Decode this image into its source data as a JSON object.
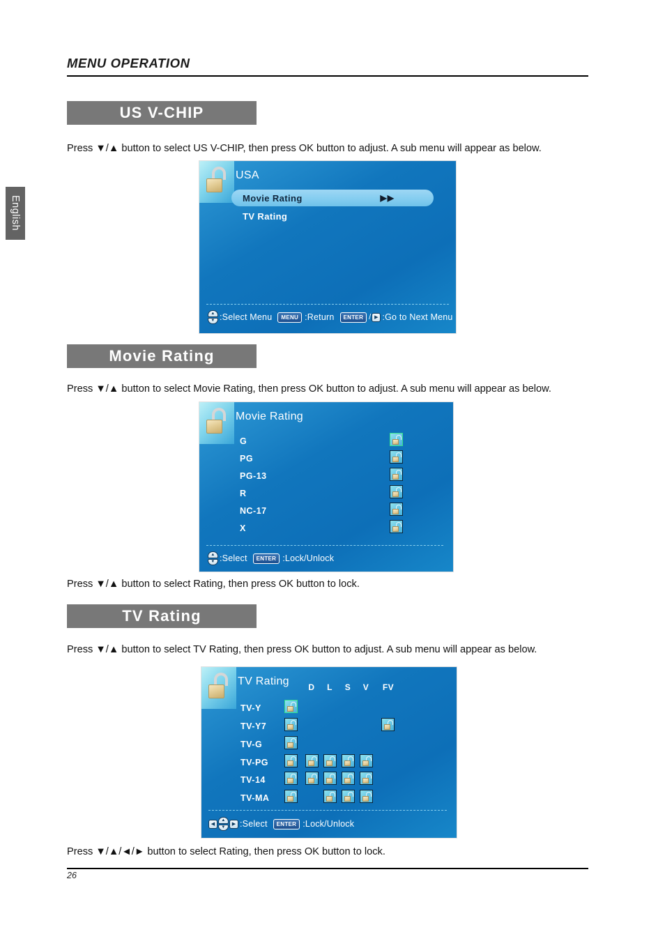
{
  "page": {
    "running_head": "MENU OPERATION",
    "page_number": "26",
    "language_tab": "English"
  },
  "sections": [
    {
      "id": "us-vchip",
      "title": "US  V-CHIP",
      "paragraph": "Press ▼/▲ button to select US V-CHIP, then press OK button to adjust. A sub menu will appear as below."
    },
    {
      "id": "movie-rating",
      "title": "Movie  Rating",
      "paragraph": "Press ▼/▲ button to select Movie Rating, then press OK button to adjust. A sub menu will appear as below.",
      "after_paragraph": "Press ▼/▲ button to select Rating, then press OK button to lock."
    },
    {
      "id": "tv-rating",
      "title": "TV  Rating",
      "paragraph": "Press ▼/▲ button to select TV Rating, then press OK button to adjust. A sub menu will appear as below.",
      "after_paragraph": "Press ▼/▲/◄/► button to select Rating, then press OK button to lock."
    }
  ],
  "osd_usa": {
    "title": "USA",
    "lock_icon": "open-padlock-icon",
    "items": [
      {
        "label": "Movie  Rating",
        "selected": true,
        "arrows": "▶▶"
      },
      {
        "label": "TV  Rating",
        "selected": false
      }
    ],
    "footer": {
      "select_icon": "up-down-key-icon",
      "select_label": ":Select Menu",
      "menu_key": "MENU",
      "return_label": ":Return",
      "enter_key": "ENTER",
      "right_key_icon": "right-arrow-key-icon",
      "next_label": ":Go to Next Menu"
    }
  },
  "osd_movie": {
    "title": "Movie  Rating",
    "lock_icon": "open-padlock-icon",
    "ratings": [
      {
        "label": "G",
        "locked": false,
        "selected": true
      },
      {
        "label": "PG",
        "locked": false,
        "selected": false
      },
      {
        "label": "PG-13",
        "locked": false,
        "selected": false
      },
      {
        "label": "R",
        "locked": false,
        "selected": false
      },
      {
        "label": "NC-17",
        "locked": false,
        "selected": false
      },
      {
        "label": "X",
        "locked": false,
        "selected": false
      }
    ],
    "footer": {
      "select_icon": "up-down-key-icon",
      "select_label": ":Select",
      "enter_key": "ENTER",
      "lock_label": ":Lock/Unlock"
    }
  },
  "osd_tv": {
    "title": "TV  Rating",
    "lock_icon": "open-padlock-icon",
    "columns": [
      "D",
      "L",
      "S",
      "V",
      "FV"
    ],
    "rows": [
      {
        "label": "TV-Y",
        "base": true,
        "base_selected": true,
        "cells": [
          false,
          false,
          false,
          false,
          false
        ]
      },
      {
        "label": "TV-Y7",
        "base": true,
        "base_selected": false,
        "cells": [
          false,
          false,
          false,
          false,
          true
        ]
      },
      {
        "label": "TV-G",
        "base": true,
        "base_selected": false,
        "cells": [
          false,
          false,
          false,
          false,
          false
        ]
      },
      {
        "label": "TV-PG",
        "base": true,
        "base_selected": false,
        "cells": [
          true,
          true,
          true,
          true,
          false
        ]
      },
      {
        "label": "TV-14",
        "base": true,
        "base_selected": false,
        "cells": [
          true,
          true,
          true,
          true,
          false
        ]
      },
      {
        "label": "TV-MA",
        "base": true,
        "base_selected": false,
        "cells": [
          false,
          true,
          true,
          true,
          false
        ]
      }
    ],
    "footer": {
      "left_key_icon": "left-arrow-key-icon",
      "select_icon": "up-down-key-icon",
      "right_key_icon": "right-arrow-key-icon",
      "select_label": ":Select",
      "enter_key": "ENTER",
      "lock_label": ":Lock/Unlock"
    }
  },
  "colors": {
    "title_bar": "#787878",
    "osd_blue": "#1176bd",
    "highlight": "#84cdf0",
    "selected_border": "#35e08a"
  }
}
